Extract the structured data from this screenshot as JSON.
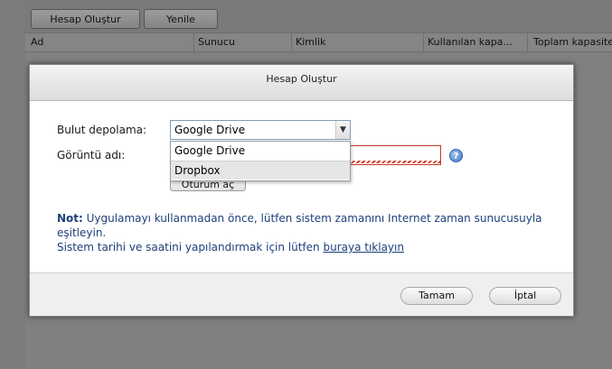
{
  "toolbar": {
    "create_account_label": "Hesap Oluştur",
    "refresh_label": "Yenile"
  },
  "table": {
    "columns": [
      "Ad",
      "Sunucu",
      "Kimlik",
      "Kullanılan kapa...",
      "Toplam kapasite"
    ]
  },
  "dialog": {
    "title": "Hesap Oluştur",
    "cloud_storage_label": "Bulut depolama:",
    "display_name_label": "Görüntü adı:",
    "selected_storage": "Google Drive",
    "options": [
      "Google Drive",
      "Dropbox"
    ],
    "login_button": "Oturum aç",
    "help_icon": "question-icon",
    "note_prefix": "Not:",
    "note_line1_text": " Uygulamayı kullanmadan önce, lütfen sistem zamanını Internet zaman sunucusuyla eşitleyin.",
    "note_line2_text": "Sistem tarihi ve saatini yapılandırmak için lütfen ",
    "note_link": "buraya tıklayın",
    "ok_button": "Tamam",
    "cancel_button": "İptal"
  }
}
